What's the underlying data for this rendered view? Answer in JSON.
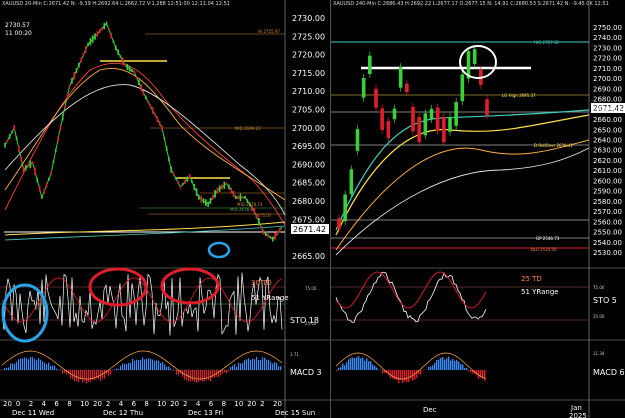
{
  "left": {
    "header": "XAUUSD 20-Min C:2671.42 N: -9.39 H:2692.64 L:2662.72 V:1,288 12:51:00 12:11:04 12:51",
    "header2": "",
    "peak_label": "2730.57",
    "peak_time": "11 00:20",
    "price_labels": {
      "hi": "Hi 2725.97",
      "mid": "MID 2699.23",
      "wc1": "MID 2678.74",
      "wc2": "MID 2676.54",
      "lo": "2675.07"
    },
    "price_box": "2671.42",
    "sto_td": "30 TD",
    "sto_range": "51 YRange",
    "sto_label": "STO 18",
    "macd_label": "MACD 3",
    "sto_levels": [
      "75.00",
      "25.00"
    ],
    "macd_level": "3.71",
    "x_ticks": [
      "20",
      "0",
      "2",
      "4",
      "6",
      "8",
      "10",
      "20",
      "2",
      "4",
      "6",
      "8",
      "10",
      "20",
      "2",
      "4",
      "6",
      "8",
      "10",
      "20",
      "2",
      "20"
    ],
    "date_labels": [
      "Dec 11 Wed",
      "Dec 12 Thu",
      "Dec 13 Fri",
      "Dec 15 Sun"
    ]
  },
  "mid_axis": {
    "ticks": [
      "2730.00",
      "2725.00",
      "2720.00",
      "2715.00",
      "2710.00",
      "2705.00",
      "2700.00",
      "2695.00",
      "2690.00",
      "2685.00",
      "2680.00",
      "2675.00",
      "2671.42",
      "2665.00"
    ]
  },
  "right": {
    "header": "XAUUSD 240-Min C:2686.43 H:2692.22 L:2677.17 O:2677.15 N: 14.91 C:2680.53 S:2671.42 N: -9.45.0K 12:51",
    "price_labels": {
      "hi": "HIG 2727.32",
      "lg": "LG High 2695.37",
      "roll": "D RollOver 2636.41",
      "gp": "GP 2546.73",
      "blu": "BLU 2535.50"
    },
    "price_box": "2671.42",
    "sto_td": "25 TD",
    "sto_range": "51 YRange",
    "sto_label": "STO 5",
    "macd_label": "MACD 6",
    "sto_levels": [
      "75.00",
      "25.00"
    ],
    "macd_level": "11.34",
    "macd_level2": "11.34",
    "x_labels": [
      "Dec",
      "Jan",
      "2025"
    ],
    "axis_ticks": [
      "2750.00",
      "2740.00",
      "2730.00",
      "2720.00",
      "2710.00",
      "2700.00",
      "2690.00",
      "2680.00",
      "2670.00",
      "2660.00",
      "2650.00",
      "2640.00",
      "2630.00",
      "2620.00",
      "2610.00",
      "2600.00",
      "2590.00",
      "2580.00",
      "2570.00",
      "2560.00",
      "2550.00",
      "2540.00",
      "2530.00"
    ]
  },
  "chart_data": [
    {
      "type": "line",
      "title": "",
      "xlabel": "",
      "ylabel": "",
      "ylim": [
        2662,
        2731
      ],
      "x": [
        0,
        2,
        4,
        6,
        8,
        10,
        12,
        14,
        16,
        18,
        20,
        22,
        24,
        26,
        28,
        30,
        32,
        34,
        36,
        38,
        40,
        42,
        44,
        46,
        48,
        50,
        52,
        54,
        56,
        58,
        60
      ],
      "series": [
        {
          "name": "",
          "values": [
            2695,
            2700,
            2688,
            2690,
            2680,
            2687,
            2700,
            2712,
            2718,
            2724,
            2727,
            2730,
            2723,
            2718,
            2716,
            2710,
            2705,
            2700,
            2688,
            2683,
            2686,
            2680,
            2678,
            2682,
            2684,
            2680,
            2680,
            2676,
            2670,
            2668,
            2671.42
          ]
        }
      ]
    },
    {
      "type": "line",
      "title": "",
      "xlabel": "",
      "ylabel": "",
      "ylim": [
        2525,
        2755
      ],
      "x": [
        0,
        1,
        2,
        3,
        4,
        5,
        6,
        7,
        8,
        9,
        10,
        11,
        12,
        13,
        14,
        15,
        16,
        17,
        18,
        19,
        20,
        21,
        22,
        23,
        24
      ],
      "series": [
        {
          "name": "",
          "values": [
            2560,
            2575,
            2600,
            2640,
            2690,
            2712,
            2680,
            2660,
            2650,
            2665,
            2700,
            2690,
            2660,
            2650,
            2655,
            2665,
            2660,
            2650,
            2655,
            2665,
            2690,
            2712,
            2720,
            2700,
            2671.42
          ]
        }
      ]
    }
  ]
}
